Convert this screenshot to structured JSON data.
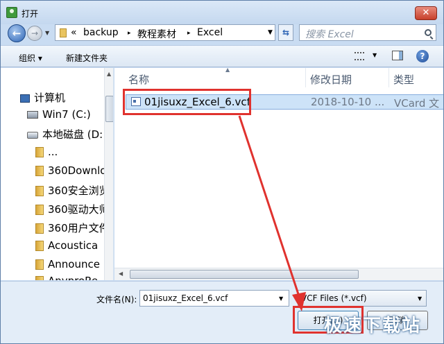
{
  "window": {
    "title": "打开",
    "close_label": "✕"
  },
  "navigation": {
    "back_icon": "←",
    "forward_icon": "→",
    "path_prefix": "«",
    "breadcrumbs": [
      "backup",
      "教程素材",
      "Excel"
    ],
    "separator": "▸",
    "search_placeholder": "搜索 Excel"
  },
  "toolbar": {
    "organize_label": "组织 ▾",
    "new_folder_label": "新建文件夹",
    "help_label": "?"
  },
  "sidebar": {
    "items": [
      {
        "label": "计算机",
        "icon": "computer-icon"
      },
      {
        "label": "Win7 (C:)",
        "icon": "windows-drive-icon"
      },
      {
        "label": "本地磁盘 (D:",
        "icon": "drive-icon"
      },
      {
        "label": "...",
        "icon": "folder-icon"
      },
      {
        "label": "360Downlo",
        "icon": "folder-icon"
      },
      {
        "label": "360安全浏览",
        "icon": "folder-icon"
      },
      {
        "label": "360驱动大师",
        "icon": "folder-icon"
      },
      {
        "label": "360用户文件",
        "icon": "folder-icon"
      },
      {
        "label": "Acoustica",
        "icon": "folder-icon"
      },
      {
        "label": "Announce",
        "icon": "folder-icon"
      },
      {
        "label": "AnyproRe",
        "icon": "folder-icon"
      }
    ]
  },
  "file_list": {
    "columns": [
      "名称",
      "修改日期",
      "类型"
    ],
    "rows": [
      {
        "name": "01jisuxz_Excel_6.vcf",
        "date": "2018-10-10 ...",
        "type": "VCard 文"
      }
    ]
  },
  "bottom": {
    "filename_label": "文件名(N):",
    "filename_value": "01jisuxz_Excel_6.vcf",
    "filter_value": "VCF Files (*.vcf)",
    "open_label": "打开(O)",
    "cancel_label": "取消"
  },
  "watermark": "极速下载站",
  "colors": {
    "highlight": "#e0322e",
    "selection": "#cde3f8",
    "chrome": "#c9dcf2"
  }
}
